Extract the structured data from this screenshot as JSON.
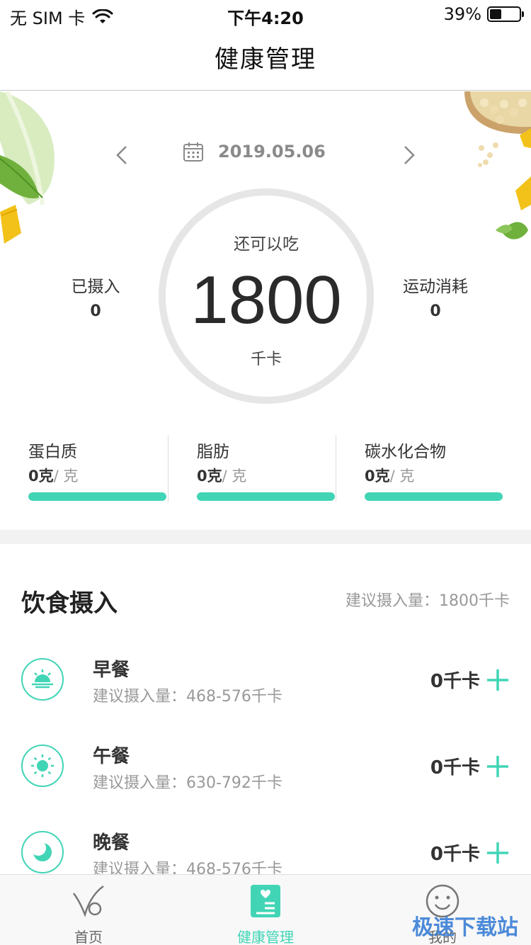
{
  "status_bar": {
    "carrier": "无 SIM 卡",
    "time": "下午4:20",
    "battery": "39%",
    "battery_level": 0.39
  },
  "nav": {
    "title": "健康管理"
  },
  "summary": {
    "date": "2019.05.06",
    "remaining_label": "还可以吃",
    "remaining_value": "1800",
    "remaining_unit": "千卡",
    "intake_label": "已摄入",
    "intake_value": "0",
    "burn_label": "运动消耗",
    "burn_value": "0",
    "nutrients": [
      {
        "name": "蛋白质",
        "value": "0克",
        "unit": "/ 克",
        "progress": 1.0
      },
      {
        "name": "脂肪",
        "value": "0克",
        "unit": "/ 克",
        "progress": 1.0
      },
      {
        "name": "碳水化合物",
        "value": "0克",
        "unit": "/ 克",
        "progress": 1.0
      }
    ]
  },
  "diet": {
    "title": "饮食摄入",
    "suggest": "建议摄入量：1800千卡",
    "meals": [
      {
        "name": "早餐",
        "range": "建议摄入量：468-576千卡",
        "kcal": "0千卡",
        "icon": "sunrise-icon"
      },
      {
        "name": "午餐",
        "range": "建议摄入量：630-792千卡",
        "kcal": "0千卡",
        "icon": "sun-icon"
      },
      {
        "name": "晚餐",
        "range": "建议摄入量：468-576千卡",
        "kcal": "0千卡",
        "icon": "moon-icon"
      }
    ]
  },
  "tabs": [
    {
      "label": "首页",
      "icon": "home-logo-icon"
    },
    {
      "label": "健康管理",
      "icon": "health-icon",
      "active": true
    },
    {
      "label": "我的",
      "icon": "smile-icon"
    }
  ],
  "watermark": "极速下载站",
  "colors": {
    "accent": "#41d5b6",
    "ring": "#e6e6e6"
  }
}
